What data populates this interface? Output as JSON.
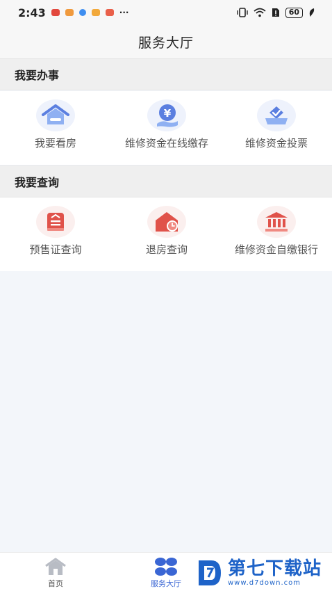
{
  "status_bar": {
    "time": "2:43",
    "more": "···",
    "battery": "60"
  },
  "header": {
    "title": "服务大厅"
  },
  "sections": [
    {
      "title": "我要办事",
      "items": [
        {
          "label": "我要看房",
          "icon": "house-icon"
        },
        {
          "label": "维修资金在线缴存",
          "icon": "yuan-hand-icon"
        },
        {
          "label": "维修资金投票",
          "icon": "vote-box-icon"
        }
      ]
    },
    {
      "title": "我要查询",
      "items": [
        {
          "label": "预售证查询",
          "icon": "certificate-icon"
        },
        {
          "label": "退房查询",
          "icon": "house-clock-icon"
        },
        {
          "label": "维修资金自缴银行",
          "icon": "bank-icon"
        }
      ]
    }
  ],
  "tab_bar": {
    "tabs": [
      {
        "label": "首页",
        "icon": "home-icon"
      },
      {
        "label": "服务大厅",
        "icon": "grid-icon",
        "active": true
      }
    ]
  },
  "watermark": {
    "brand": "第七下载站",
    "url": "www.d7down.com"
  },
  "colors": {
    "accent_blue": "#4a6fd8",
    "accent_red": "#e0524a",
    "tab_active": "#3a66d4",
    "tab_inactive": "#555555"
  }
}
